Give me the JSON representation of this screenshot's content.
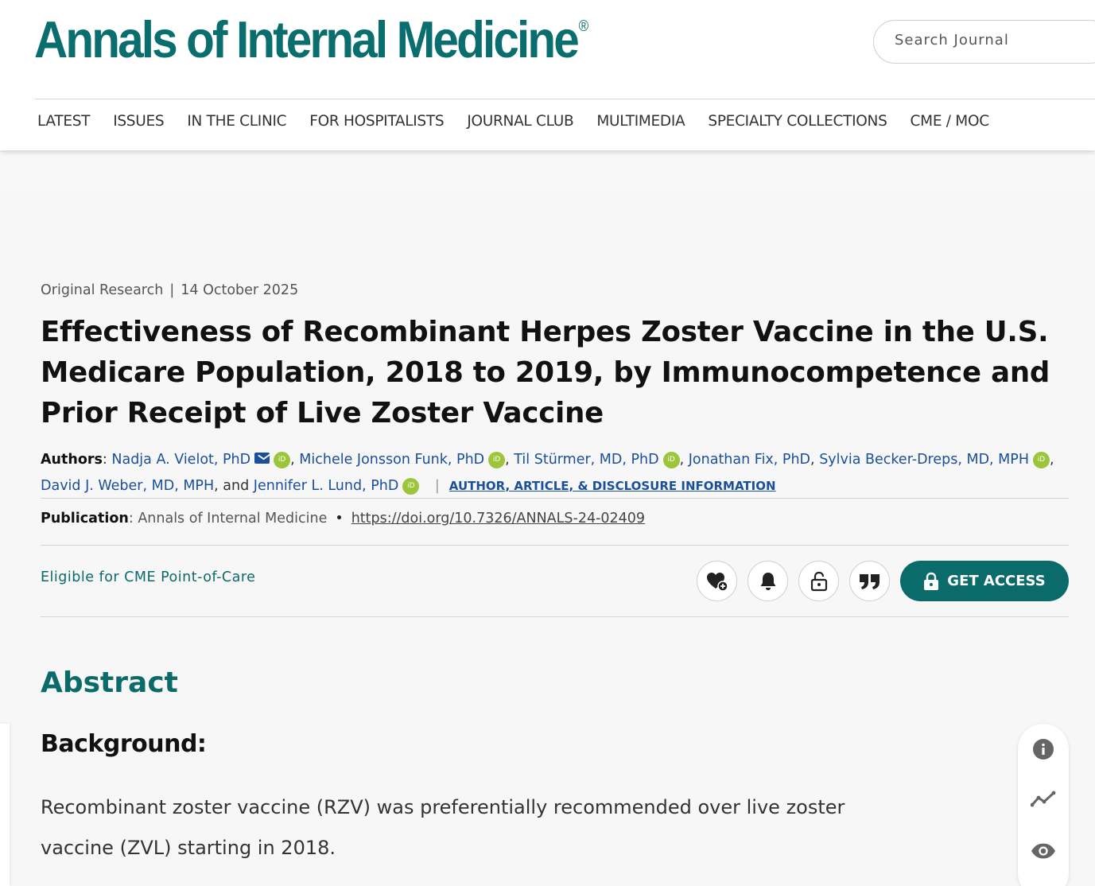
{
  "header": {
    "logo": "Annals of Internal Medicine",
    "logo_mark": "®",
    "search_placeholder": "Search Journal",
    "nav": [
      "LATEST",
      "ISSUES",
      "IN THE CLINIC",
      "FOR HOSPITALISTS",
      "JOURNAL CLUB",
      "MULTIMEDIA",
      "SPECIALTY COLLECTIONS",
      "CME / MOC"
    ]
  },
  "article": {
    "type": "Original Research",
    "meta_separator": "|",
    "date": "14 October 2025",
    "title": "Effectiveness of Recombinant Herpes Zoster Vaccine in the U.S. Medicare Population, 2018 to 2019, by Immunocompetence and Prior Receipt of Live Zoster Vaccine",
    "authors_label": "Authors",
    "authors": [
      "Nadja A. Vielot, PhD",
      "Michele Jonsson Funk, PhD",
      "Til Stürmer, MD, PhD",
      "Jonathan Fix, PhD",
      "Sylvia Becker-Dreps, MD, MPH",
      "David J. Weber, MD, MPH",
      "Jennifer L. Lund, PhD"
    ],
    "authors_conjunction": "and",
    "orcid_label": "iD",
    "info_separator": "|",
    "info_link": "AUTHOR, ARTICLE, & DISCLOSURE INFORMATION",
    "publication_label": "Publication",
    "publication": "Annals of Internal Medicine",
    "publication_dot": "•",
    "doi": "https://doi.org/10.7326/ANNALS-24-02409",
    "cme": "Eligible for CME Point-of-Care",
    "get_access": "GET ACCESS"
  },
  "abstract": {
    "heading": "Abstract",
    "section_heading": "Background:",
    "text": "Recombinant zoster vaccine (RZV) was preferentially recommended over live zoster vaccine (ZVL) starting in 2018."
  },
  "icons": {
    "actions": [
      "favorite-add-icon",
      "bell-icon",
      "unlock-icon",
      "quote-icon"
    ],
    "get_access": "lock-icon",
    "side": [
      "info-icon",
      "metrics-icon",
      "eye-icon"
    ],
    "author_contact": "mail-icon"
  },
  "colors": {
    "brand": "#0a6e6e",
    "link": "#1a4f9c",
    "orcid": "#9cc53b"
  }
}
